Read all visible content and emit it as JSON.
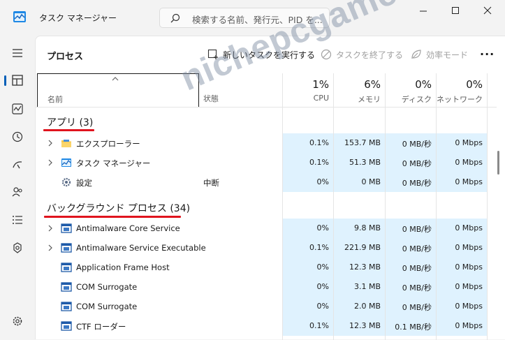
{
  "window": {
    "title": "タスク マネージャー",
    "search_placeholder": "検索する名前、発行元、PID を..."
  },
  "toolbar": {
    "page_title": "プロセス",
    "run_task": "新しいタスクを実行する",
    "end_task": "タスクを終了する",
    "efficiency": "効率モード"
  },
  "columns": {
    "name": "名前",
    "status": "状態",
    "cpu": {
      "pct": "1%",
      "label": "CPU"
    },
    "memory": {
      "pct": "6%",
      "label": "メモリ"
    },
    "disk": {
      "pct": "0%",
      "label": "ディスク"
    },
    "network": {
      "pct": "0%",
      "label": "ネットワーク"
    }
  },
  "groups": {
    "apps": {
      "title": "アプリ (3)"
    },
    "background": {
      "title": "バックグラウンド プロセス (34)"
    }
  },
  "apps": [
    {
      "name": "エクスプローラー",
      "status": "",
      "cpu": "0.1%",
      "mem": "153.7 MB",
      "disk": "0 MB/秒",
      "net": "0 Mbps"
    },
    {
      "name": "タスク マネージャー",
      "status": "",
      "cpu": "0.1%",
      "mem": "51.3 MB",
      "disk": "0 MB/秒",
      "net": "0 Mbps"
    },
    {
      "name": "設定",
      "status": "中断",
      "cpu": "0%",
      "mem": "0 MB",
      "disk": "0 MB/秒",
      "net": "0 Mbps"
    }
  ],
  "background": [
    {
      "name": "Antimalware Core Service",
      "status": "",
      "cpu": "0%",
      "mem": "9.8 MB",
      "disk": "0 MB/秒",
      "net": "0 Mbps"
    },
    {
      "name": "Antimalware Service Executable",
      "status": "",
      "cpu": "0.1%",
      "mem": "221.9 MB",
      "disk": "0 MB/秒",
      "net": "0 Mbps"
    },
    {
      "name": "Application Frame Host",
      "status": "",
      "cpu": "0%",
      "mem": "12.3 MB",
      "disk": "0 MB/秒",
      "net": "0 Mbps"
    },
    {
      "name": "COM Surrogate",
      "status": "",
      "cpu": "0%",
      "mem": "3.1 MB",
      "disk": "0 MB/秒",
      "net": "0 Mbps"
    },
    {
      "name": "COM Surrogate",
      "status": "",
      "cpu": "0%",
      "mem": "2.0 MB",
      "disk": "0 MB/秒",
      "net": "0 Mbps"
    },
    {
      "name": "CTF ローダー",
      "status": "",
      "cpu": "0.1%",
      "mem": "12.3 MB",
      "disk": "0.1 MB/秒",
      "net": "0 Mbps"
    }
  ],
  "watermark": "nichepcgamer.com",
  "colors": {
    "accent": "#005fb8",
    "highlight": "#dff2fe",
    "annotation": "#e0141e"
  }
}
